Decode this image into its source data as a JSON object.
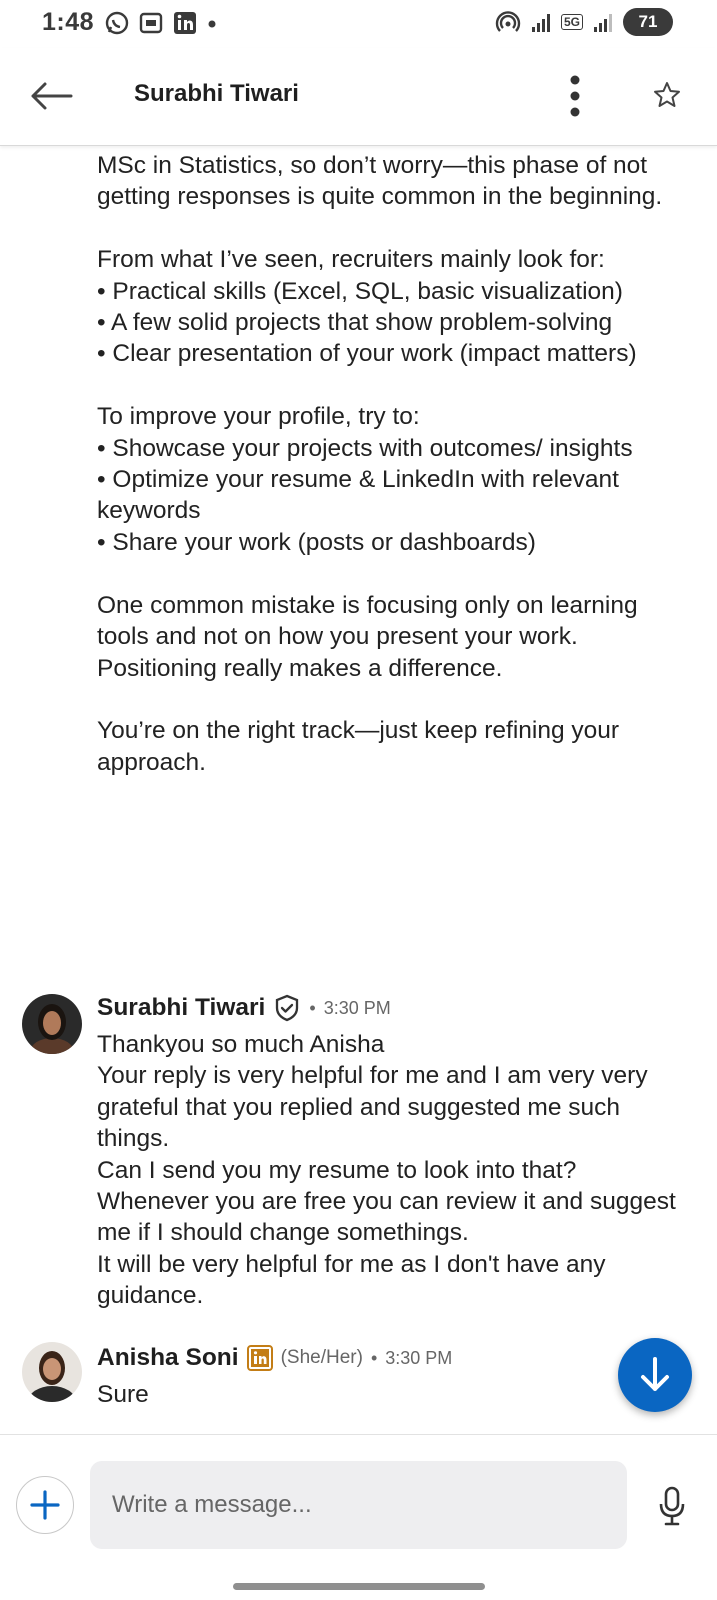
{
  "status_bar": {
    "time": "1:48",
    "battery": "71",
    "network": "5G"
  },
  "header": {
    "title": "Surabhi Tiwari"
  },
  "thread": {
    "continued_text": "MSc in Statistics, so don’t worry—this phase of not getting responses is quite common in the beginning.\n\nFrom what I’ve seen, recruiters mainly look for:\n• Practical skills (Excel, SQL, basic visualization)\n• A few solid projects that show problem-solving\n• Clear presentation of your work (impact matters)\n\nTo improve your profile, try to:\n• Showcase your projects with outcomes/ insights\n• Optimize your resume & LinkedIn with relevant keywords\n• Share your work (posts or dashboards)\n\nOne common mistake is focusing only on learning tools and not on how you present your work. Positioning really makes a difference.\n\nYou’re on the right track—just keep refining your approach.",
    "messages": [
      {
        "sender": "Surabhi Tiwari",
        "separator": "•",
        "time": "3:30 PM",
        "text": "Thankyou so much Anisha\nYour reply is very helpful for me and I am very very grateful that you replied and suggested me such things.\nCan I send you my resume to look into that? Whenever you are free you can review it and suggest me if I should change somethings.\nIt will be very helpful for me as I don't have any guidance."
      },
      {
        "sender": "Anisha Soni",
        "pronouns": "(She/Her)",
        "separator": "•",
        "time": "3:30 PM",
        "text": "Sure"
      }
    ]
  },
  "compose": {
    "placeholder": "Write a message..."
  },
  "colors": {
    "accent": "#0a66c2",
    "linkedin_badge": "#c37d16"
  }
}
